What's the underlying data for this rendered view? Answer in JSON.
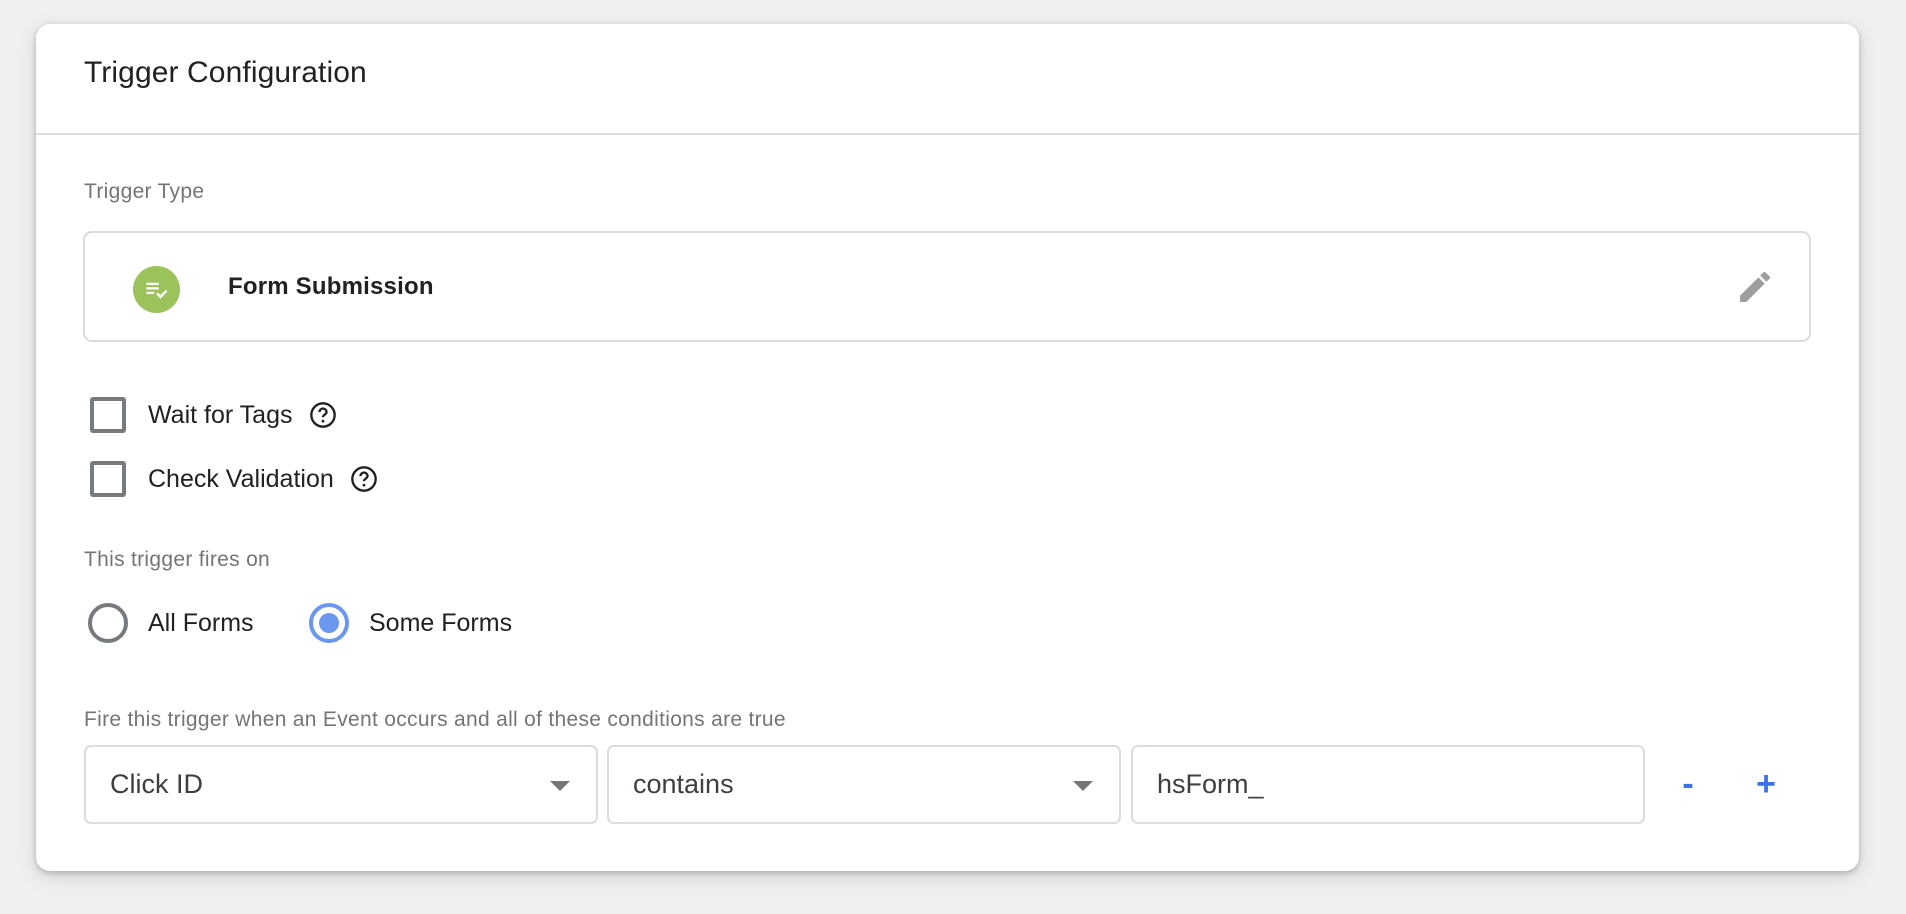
{
  "card": {
    "title": "Trigger Configuration"
  },
  "trigger_type": {
    "label": "Trigger Type",
    "name": "Form Submission",
    "icon": "form-check-icon",
    "icon_color": "#9bc25b",
    "edit_icon": "pencil-icon"
  },
  "options": [
    {
      "label": "Wait for Tags",
      "checked": false,
      "help_icon": "help-circle-icon"
    },
    {
      "label": "Check Validation",
      "checked": false,
      "help_icon": "help-circle-icon"
    }
  ],
  "fires_on": {
    "label": "This trigger fires on",
    "choices": [
      {
        "label": "All Forms",
        "selected": false
      },
      {
        "label": "Some Forms",
        "selected": true
      }
    ]
  },
  "conditions": {
    "label": "Fire this trigger when an Event occurs and all of these conditions are true",
    "rows": [
      {
        "variable": "Click ID",
        "operator": "contains",
        "value": "hsForm_"
      }
    ],
    "remove_label": "-",
    "add_label": "+"
  },
  "colors": {
    "accent": "#3a74e0",
    "radio_selected": "#6a98ee"
  }
}
